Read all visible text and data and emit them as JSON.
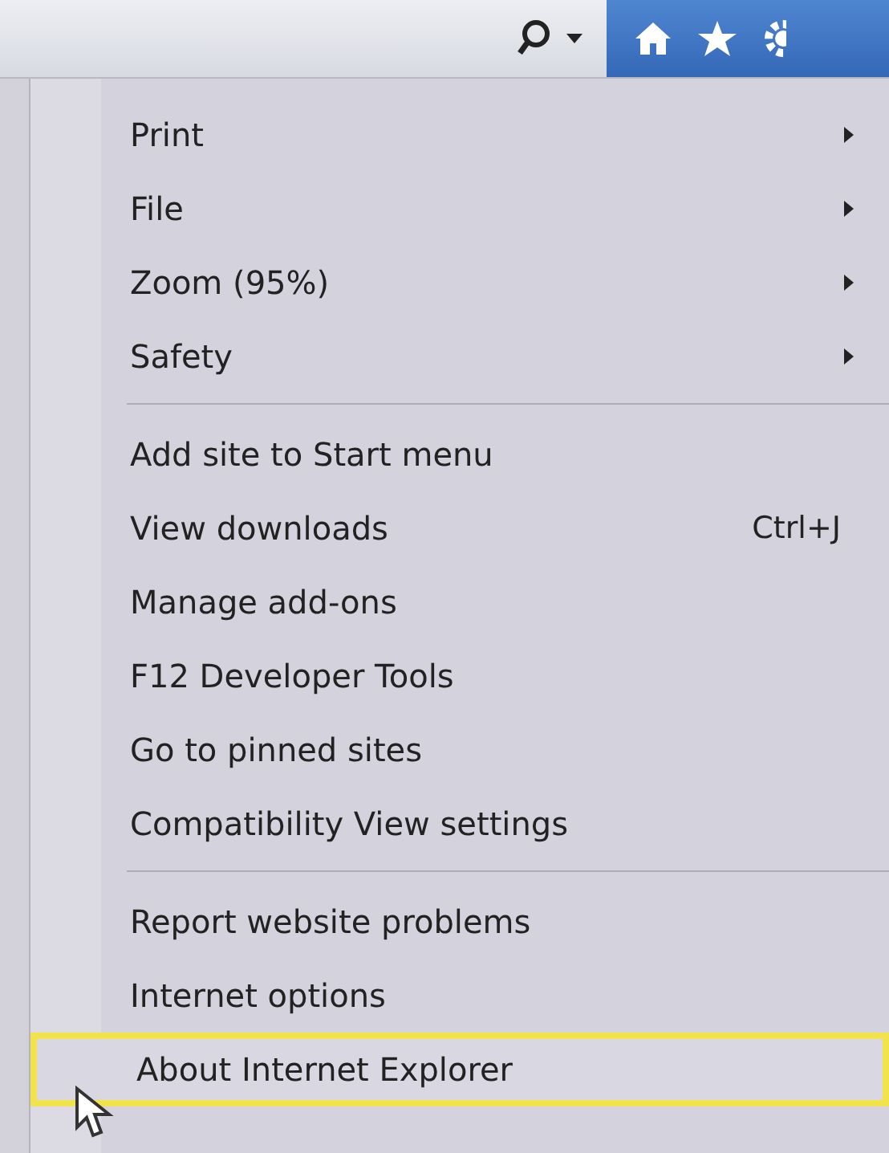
{
  "toolbar": {
    "search_dropdown": true
  },
  "menu": {
    "groups": [
      [
        {
          "label": "Print",
          "has_submenu": true,
          "selected": false
        },
        {
          "label": "File",
          "has_submenu": true,
          "selected": false
        },
        {
          "label": "Zoom (95%)",
          "has_submenu": true,
          "selected": false
        },
        {
          "label": "Safety",
          "has_submenu": true,
          "selected": false
        }
      ],
      [
        {
          "label": "Add site to Start menu",
          "has_submenu": false,
          "selected": false
        },
        {
          "label": "View downloads",
          "shortcut": "Ctrl+J",
          "has_submenu": false,
          "selected": false
        },
        {
          "label": "Manage add-ons",
          "has_submenu": false,
          "selected": false
        },
        {
          "label": "F12 Developer Tools",
          "has_submenu": false,
          "selected": false
        },
        {
          "label": "Go to pinned sites",
          "has_submenu": false,
          "selected": false
        },
        {
          "label": "Compatibility View settings",
          "has_submenu": false,
          "selected": false
        }
      ],
      [
        {
          "label": "Report website problems",
          "has_submenu": false,
          "selected": false
        },
        {
          "label": "Internet options",
          "has_submenu": false,
          "selected": false
        },
        {
          "label": "About Internet Explorer",
          "has_submenu": false,
          "selected": true
        }
      ]
    ]
  }
}
